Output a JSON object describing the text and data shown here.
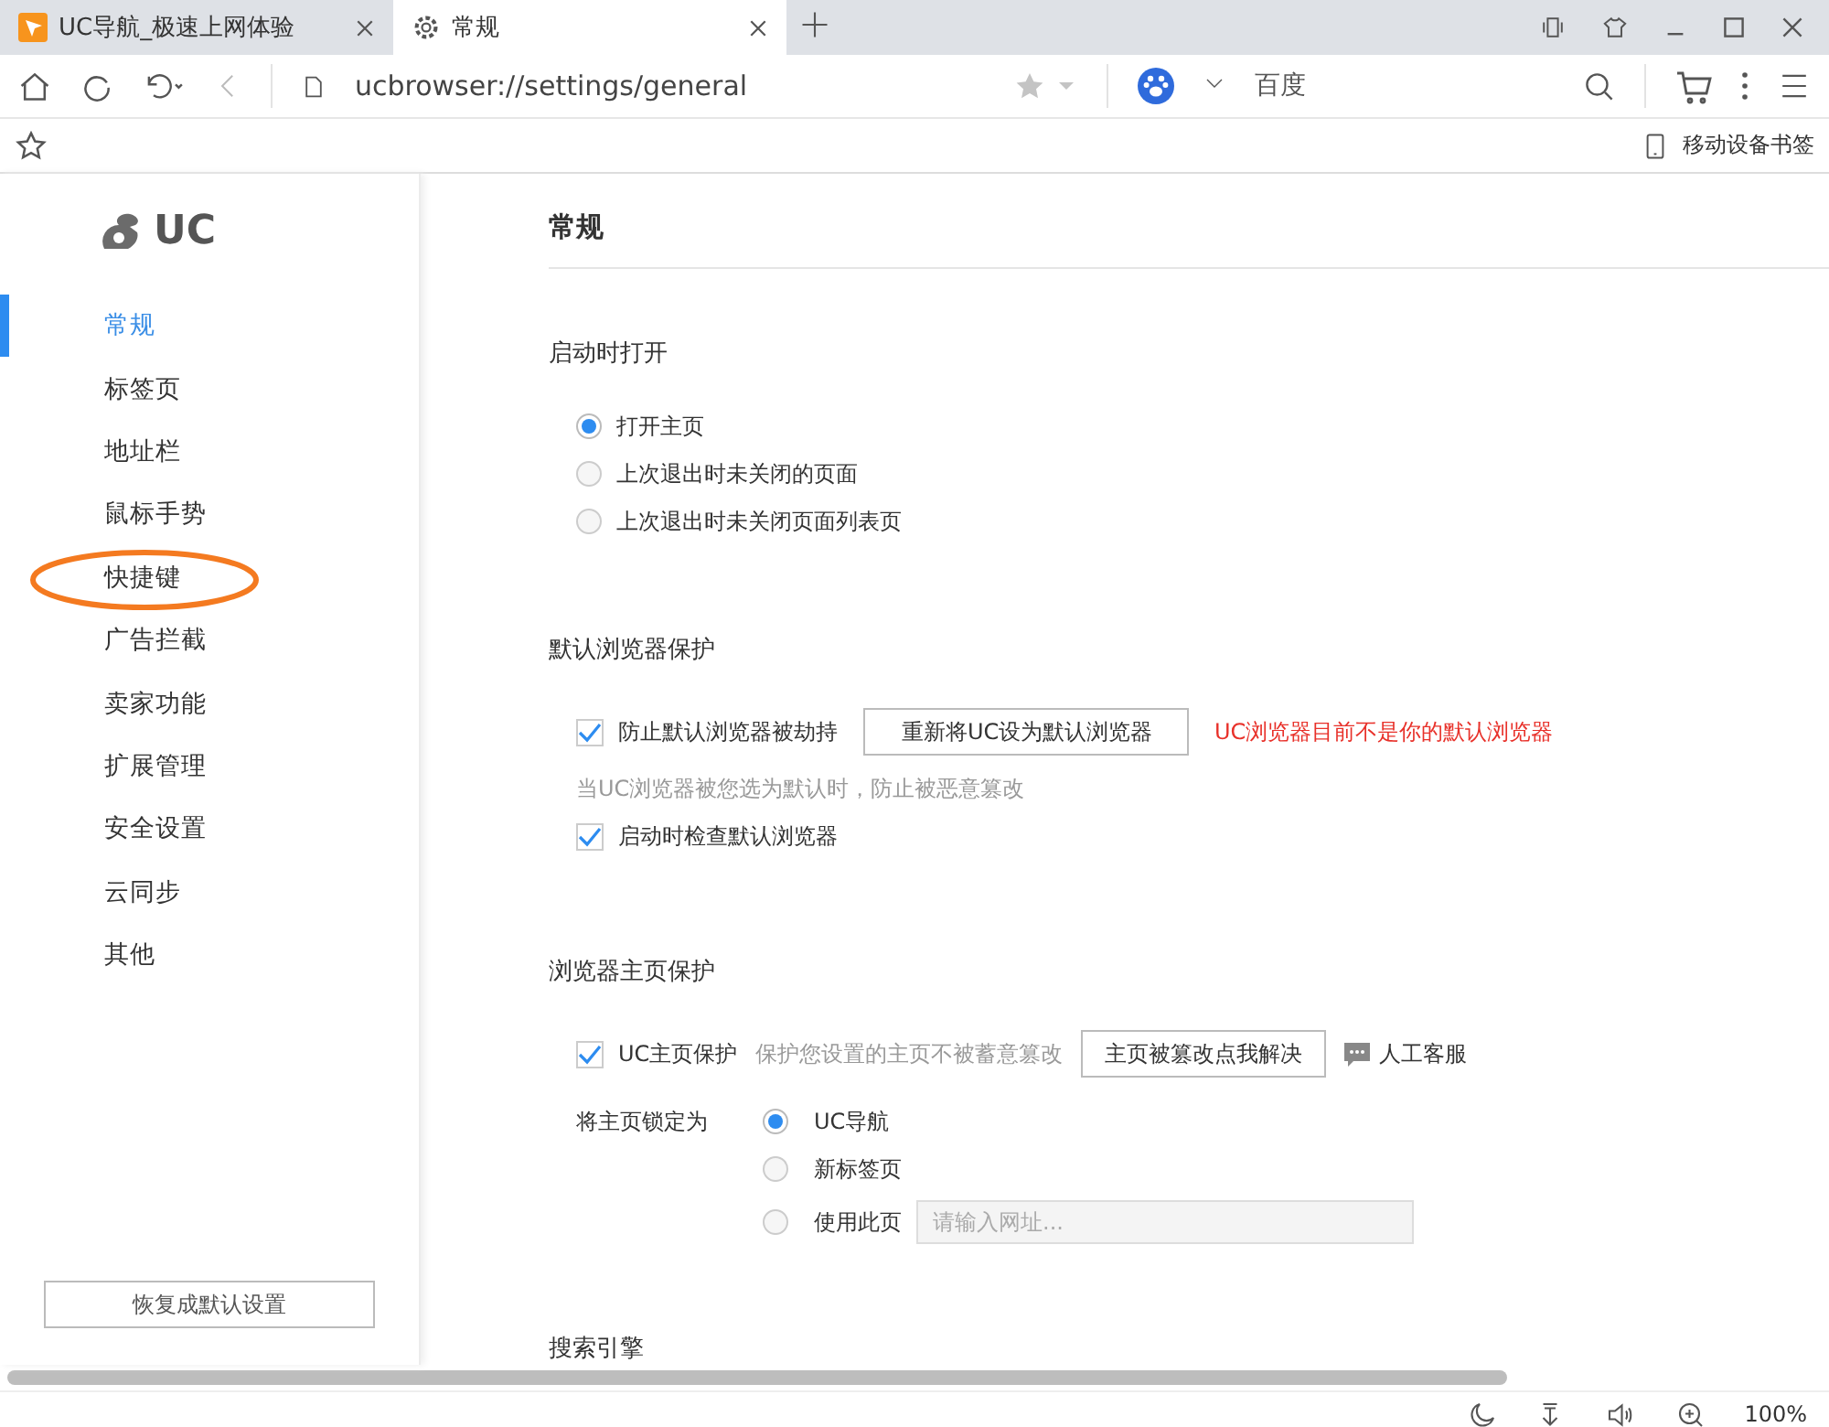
{
  "tabs": [
    {
      "title": "UC导航_极速上网体验",
      "kind": "site",
      "selected": false
    },
    {
      "title": "常规",
      "kind": "settings",
      "selected": true
    }
  ],
  "toolbar": {
    "url": "ucbrowser://settings/general",
    "search_engine": "百度"
  },
  "bookmarks_bar": {
    "mobile_bookmarks": "移动设备书签"
  },
  "sidebar": {
    "logo": "UC",
    "items": [
      {
        "label": "常规",
        "selected": true
      },
      {
        "label": "标签页",
        "selected": false
      },
      {
        "label": "地址栏",
        "selected": false
      },
      {
        "label": "鼠标手势",
        "selected": false
      },
      {
        "label": "快捷键",
        "selected": false,
        "circled": true
      },
      {
        "label": "广告拦截",
        "selected": false
      },
      {
        "label": "卖家功能",
        "selected": false
      },
      {
        "label": "扩展管理",
        "selected": false
      },
      {
        "label": "安全设置",
        "selected": false
      },
      {
        "label": "云同步",
        "selected": false
      },
      {
        "label": "其他",
        "selected": false
      }
    ],
    "reset_button": "恢复成默认设置"
  },
  "page_title": "常规",
  "startup": {
    "heading": "启动时打开",
    "options": [
      {
        "label": "打开主页",
        "selected": true
      },
      {
        "label": "上次退出时未关闭的页面",
        "selected": false
      },
      {
        "label": "上次退出时未关闭页面列表页",
        "selected": false
      }
    ]
  },
  "default_browser": {
    "heading": "默认浏览器保护",
    "prevent_hijack": {
      "label": "防止默认浏览器被劫持",
      "checked": true
    },
    "set_default_button": "重新将UC设为默认浏览器",
    "warning": "UC浏览器目前不是你的默认浏览器",
    "hint": "当UC浏览器被您选为默认时，防止被恶意篡改",
    "check_on_start": {
      "label": "启动时检查默认浏览器",
      "checked": true
    }
  },
  "homepage": {
    "heading": "浏览器主页保护",
    "protect": {
      "label": "UC主页保护",
      "checked": true
    },
    "hint": "保护您设置的主页不被蓄意篡改",
    "fix_button": "主页被篡改点我解决",
    "support_link": "人工客服",
    "lock_label": "将主页锁定为",
    "options": [
      {
        "label": "UC导航",
        "selected": true
      },
      {
        "label": "新标签页",
        "selected": false
      },
      {
        "label": "使用此页",
        "selected": false,
        "placeholder": "请输入网址..."
      }
    ]
  },
  "search_heading": "搜索引擎",
  "status_bar": {
    "zoom": "100%"
  }
}
